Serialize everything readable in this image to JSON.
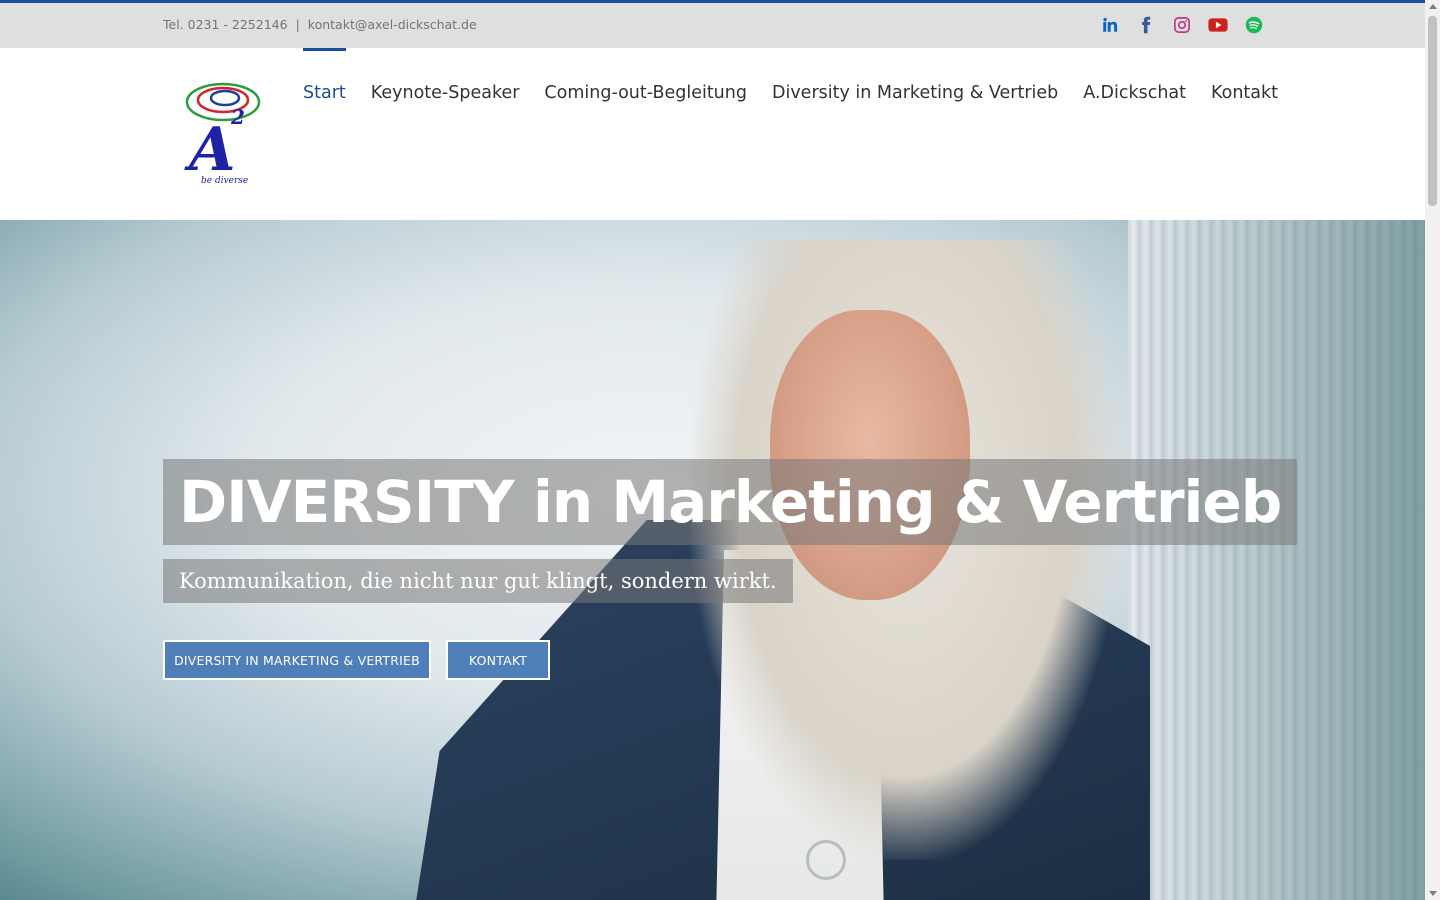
{
  "topbar": {
    "phone": "Tel. 0231 - 2252146",
    "separator": "|",
    "email": "kontakt@axel-dickschat.de",
    "social": [
      {
        "icon": "linkedin-icon",
        "color": "#0a66c2"
      },
      {
        "icon": "facebook-icon",
        "color": "#3b5998"
      },
      {
        "icon": "instagram-icon",
        "color": "#c13584"
      },
      {
        "icon": "youtube-icon",
        "color": "#cd201f"
      },
      {
        "icon": "spotify-icon",
        "color": "#1db954"
      }
    ]
  },
  "logo": {
    "letter": "A",
    "superscript": "2",
    "tagline": "be diverse"
  },
  "nav": {
    "items": [
      {
        "label": "Start",
        "active": true
      },
      {
        "label": "Keynote-Speaker"
      },
      {
        "label": "Coming-out-Begleitung"
      },
      {
        "label": "Diversity in Marketing & Vertrieb"
      },
      {
        "label": "A.Dickschat"
      },
      {
        "label": "Kontakt"
      }
    ]
  },
  "hero": {
    "headline": "DIVERSITY in Marketing & Vertrieb",
    "subline": "Kommunikation, die nicht nur gut klingt, sondern wirkt.",
    "buttons": [
      {
        "label": "DIVERSITY IN MARKETING & VERTRIEB"
      },
      {
        "label": "KONTAKT"
      }
    ]
  },
  "colors": {
    "accent": "#1a4e97",
    "button": "#4f7fb8",
    "topbar_bg": "#e0dfe0"
  }
}
